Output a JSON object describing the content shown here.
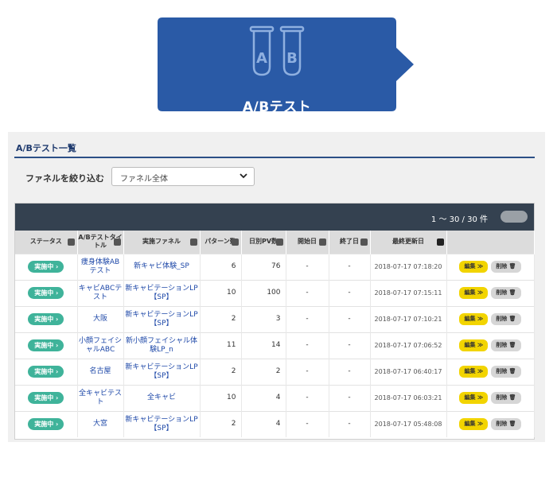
{
  "banner": {
    "title": "A/Bテスト",
    "tube_a": "A",
    "tube_b": "B",
    "bg": "#2a5aa6"
  },
  "section": {
    "title": "A/Bテスト一覧"
  },
  "filter": {
    "label": "ファネルを絞り込む",
    "selected": "ファネル全体"
  },
  "table": {
    "count": "1 〜 30 / 30 件",
    "headers": {
      "status": "ステータス",
      "title": "A/Bテストタイトル",
      "funnel": "実施ファネル",
      "patterns": "パターン数",
      "pv": "日別PV数",
      "start": "開始日",
      "end": "終了日",
      "updated": "最終更新日"
    },
    "edit_label": "編集 ≫",
    "delete_label": "削除 🗑",
    "rows": [
      {
        "status": "実施中 ›",
        "title": "痩身体験ABテスト",
        "funnel": "新キャビ体験_SP",
        "patterns": "6",
        "pv": "76",
        "start": "-",
        "end": "-",
        "updated": "2018-07-17 07:18:20"
      },
      {
        "status": "実施中 ›",
        "title": "キャビABCテスト",
        "funnel": "新キャビテーションLP【SP】",
        "patterns": "10",
        "pv": "100",
        "start": "-",
        "end": "-",
        "updated": "2018-07-17 07:15:11"
      },
      {
        "status": "実施中 ›",
        "title": "大阪",
        "funnel": "新キャビテーションLP【SP】",
        "patterns": "2",
        "pv": "3",
        "start": "-",
        "end": "-",
        "updated": "2018-07-17 07:10:21"
      },
      {
        "status": "実施中 ›",
        "title": "小顔フェイシャルABC",
        "funnel": "新小顔フェイシャル体験LP_n",
        "patterns": "11",
        "pv": "14",
        "start": "-",
        "end": "-",
        "updated": "2018-07-17 07:06:52"
      },
      {
        "status": "実施中 ›",
        "title": "名古屋",
        "funnel": "新キャビテーションLP【SP】",
        "patterns": "2",
        "pv": "2",
        "start": "-",
        "end": "-",
        "updated": "2018-07-17 06:40:17"
      },
      {
        "status": "実施中 ›",
        "title": "全キャビテスト",
        "funnel": "全キャビ",
        "patterns": "10",
        "pv": "4",
        "start": "-",
        "end": "-",
        "updated": "2018-07-17 06:03:21"
      },
      {
        "status": "実施中 ›",
        "title": "大宮",
        "funnel": "新キャビテーションLP【SP】",
        "patterns": "2",
        "pv": "4",
        "start": "-",
        "end": "-",
        "updated": "2018-07-17 05:48:08"
      }
    ]
  }
}
